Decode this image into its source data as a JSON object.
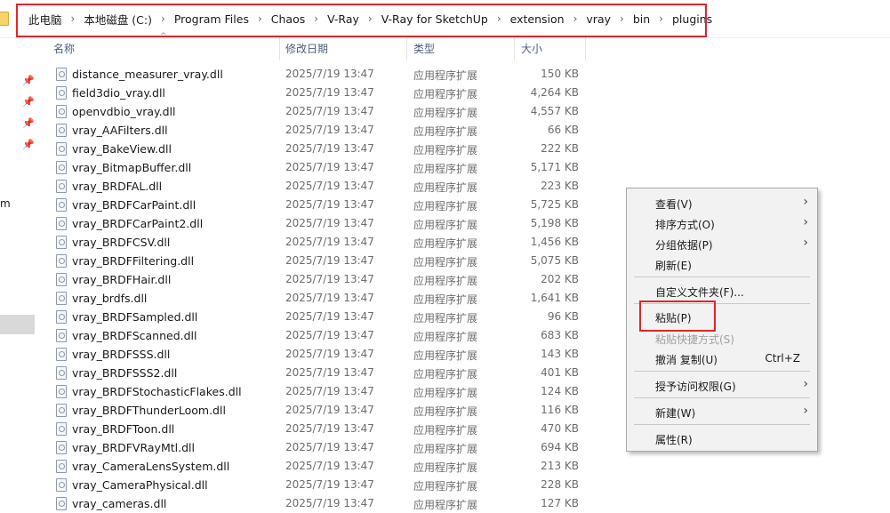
{
  "address_bar": {
    "crumbs": [
      "此电脑",
      "本地磁盘 (C:)",
      "Program Files",
      "Chaos",
      "V-Ray",
      "V-Ray for SketchUp",
      "extension",
      "vray",
      "bin",
      "plugins"
    ],
    "separator": "›"
  },
  "nav": {
    "partial_label": "m"
  },
  "columns": {
    "name": "名称",
    "date": "修改日期",
    "type": "类型",
    "size": "大小"
  },
  "files": [
    {
      "name": "distance_measurer_vray.dll",
      "date": "2025/7/19 13:47",
      "type": "应用程序扩展",
      "size": "150 KB"
    },
    {
      "name": "field3dio_vray.dll",
      "date": "2025/7/19 13:47",
      "type": "应用程序扩展",
      "size": "4,264 KB"
    },
    {
      "name": "openvdbio_vray.dll",
      "date": "2025/7/19 13:47",
      "type": "应用程序扩展",
      "size": "4,557 KB"
    },
    {
      "name": "vray_AAFilters.dll",
      "date": "2025/7/19 13:47",
      "type": "应用程序扩展",
      "size": "66 KB"
    },
    {
      "name": "vray_BakeView.dll",
      "date": "2025/7/19 13:47",
      "type": "应用程序扩展",
      "size": "222 KB"
    },
    {
      "name": "vray_BitmapBuffer.dll",
      "date": "2025/7/19 13:47",
      "type": "应用程序扩展",
      "size": "5,171 KB"
    },
    {
      "name": "vray_BRDFAL.dll",
      "date": "2025/7/19 13:47",
      "type": "应用程序扩展",
      "size": "223 KB"
    },
    {
      "name": "vray_BRDFCarPaint.dll",
      "date": "2025/7/19 13:47",
      "type": "应用程序扩展",
      "size": "5,725 KB"
    },
    {
      "name": "vray_BRDFCarPaint2.dll",
      "date": "2025/7/19 13:47",
      "type": "应用程序扩展",
      "size": "5,198 KB"
    },
    {
      "name": "vray_BRDFCSV.dll",
      "date": "2025/7/19 13:47",
      "type": "应用程序扩展",
      "size": "1,456 KB"
    },
    {
      "name": "vray_BRDFFiltering.dll",
      "date": "2025/7/19 13:47",
      "type": "应用程序扩展",
      "size": "5,075 KB"
    },
    {
      "name": "vray_BRDFHair.dll",
      "date": "2025/7/19 13:47",
      "type": "应用程序扩展",
      "size": "202 KB"
    },
    {
      "name": "vray_brdfs.dll",
      "date": "2025/7/19 13:47",
      "type": "应用程序扩展",
      "size": "1,641 KB"
    },
    {
      "name": "vray_BRDFSampled.dll",
      "date": "2025/7/19 13:47",
      "type": "应用程序扩展",
      "size": "96 KB"
    },
    {
      "name": "vray_BRDFScanned.dll",
      "date": "2025/7/19 13:47",
      "type": "应用程序扩展",
      "size": "683 KB"
    },
    {
      "name": "vray_BRDFSSS.dll",
      "date": "2025/7/19 13:47",
      "type": "应用程序扩展",
      "size": "143 KB"
    },
    {
      "name": "vray_BRDFSSS2.dll",
      "date": "2025/7/19 13:47",
      "type": "应用程序扩展",
      "size": "401 KB"
    },
    {
      "name": "vray_BRDFStochasticFlakes.dll",
      "date": "2025/7/19 13:47",
      "type": "应用程序扩展",
      "size": "124 KB"
    },
    {
      "name": "vray_BRDFThunderLoom.dll",
      "date": "2025/7/19 13:47",
      "type": "应用程序扩展",
      "size": "116 KB"
    },
    {
      "name": "vray_BRDFToon.dll",
      "date": "2025/7/19 13:47",
      "type": "应用程序扩展",
      "size": "470 KB"
    },
    {
      "name": "vray_BRDFVRayMtl.dll",
      "date": "2025/7/19 13:47",
      "type": "应用程序扩展",
      "size": "694 KB"
    },
    {
      "name": "vray_CameraLensSystem.dll",
      "date": "2025/7/19 13:47",
      "type": "应用程序扩展",
      "size": "213 KB"
    },
    {
      "name": "vray_CameraPhysical.dll",
      "date": "2025/7/19 13:47",
      "type": "应用程序扩展",
      "size": "228 KB"
    },
    {
      "name": "vray_cameras.dll",
      "date": "2025/7/19 13:47",
      "type": "应用程序扩展",
      "size": "127 KB"
    }
  ],
  "context_menu": {
    "view": "查看(V)",
    "sort_by": "排序方式(O)",
    "group_by": "分组依据(P)",
    "refresh": "刷新(E)",
    "customize_folder": "自定义文件夹(F)...",
    "paste": "粘贴(P)",
    "paste_shortcut": "粘贴快捷方式(S)",
    "undo_copy": "撤消 复制(U)",
    "undo_shortcut": "Ctrl+Z",
    "grant_access": "授予访问权限(G)",
    "new": "新建(W)",
    "properties": "属性(R)"
  },
  "icons": {
    "submenu_arrow": "chevron-right-icon",
    "breadcrumb_separator": "chevron-right-icon",
    "file": "dll-file-icon",
    "pin": "pin-icon"
  },
  "colors": {
    "highlight_box": "#e2262b",
    "menu_background": "#f2f2f2",
    "header_text": "#4c607a"
  }
}
